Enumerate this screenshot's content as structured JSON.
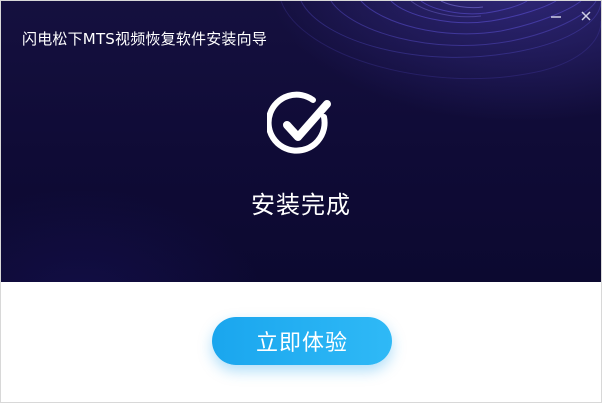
{
  "window": {
    "title": "闪电松下MTS视频恢复软件安装向导"
  },
  "controls": {
    "minimize_icon": "minimize-icon",
    "close_icon": "close-icon"
  },
  "main": {
    "status_icon": "checkmark-circle-icon",
    "status_text": "安装完成"
  },
  "footer": {
    "primary_button_label": "立即体验"
  },
  "colors": {
    "header_background": "#120d3b",
    "button_gradient_start": "#1aa6ee",
    "button_gradient_end": "#2fb9f6",
    "text": "#ffffff"
  }
}
